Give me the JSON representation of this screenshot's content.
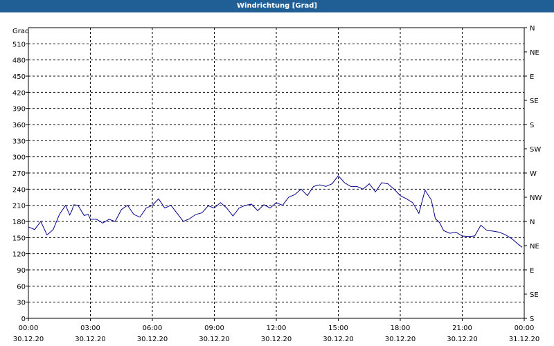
{
  "window": {
    "title": "Windrichtung [Grad]"
  },
  "chart_data": {
    "type": "line",
    "title": "Windrichtung [Grad]",
    "ylabel": "Grad",
    "xlabel": "",
    "ylim": [
      0,
      540
    ],
    "yticks": [
      0,
      30,
      60,
      90,
      120,
      150,
      180,
      210,
      240,
      270,
      300,
      330,
      360,
      390,
      420,
      450,
      480,
      510
    ],
    "right_axis_labels": [
      "S",
      "SE",
      "E",
      "NE",
      "N",
      "NW",
      "W",
      "SW",
      "S",
      "SE",
      "E",
      "NE",
      "N"
    ],
    "x_ticks": [
      {
        "time": "00:00",
        "date": "30.12.20"
      },
      {
        "time": "03:00",
        "date": "30.12.20"
      },
      {
        "time": "06:00",
        "date": "30.12.20"
      },
      {
        "time": "09:00",
        "date": "30.12.20"
      },
      {
        "time": "12:00",
        "date": "30.12.20"
      },
      {
        "time": "15:00",
        "date": "30.12.20"
      },
      {
        "time": "18:00",
        "date": "30.12.20"
      },
      {
        "time": "21:00",
        "date": "30.12.20"
      },
      {
        "time": "00:00",
        "date": "31.12.20"
      }
    ],
    "x_unit": "hours since 30.12.20 00:00",
    "grid": true,
    "line_color": "#00008b",
    "series": [
      {
        "name": "",
        "x": [
          0,
          0.3,
          0.6,
          0.9,
          1.0,
          1.2,
          1.5,
          1.8,
          2.0,
          2.1,
          2.2,
          2.4,
          2.7,
          2.9,
          3.0,
          3.3,
          3.6,
          3.9,
          4.2,
          4.5,
          4.8,
          5.1,
          5.4,
          5.7,
          6.0,
          6.3,
          6.6,
          6.9,
          7.2,
          7.5,
          7.8,
          8.1,
          8.4,
          8.7,
          9.0,
          9.3,
          9.6,
          9.9,
          10.2,
          10.5,
          10.8,
          11.1,
          11.4,
          11.7,
          12.0,
          12.3,
          12.6,
          12.9,
          13.2,
          13.5,
          13.8,
          14.1,
          14.4,
          14.7,
          15.0,
          15.3,
          15.6,
          15.9,
          16.2,
          16.5,
          16.8,
          17.1,
          17.4,
          17.7,
          18.0,
          18.3,
          18.6,
          18.9,
          19.2,
          19.5,
          19.7,
          19.9,
          20.1,
          20.4,
          20.7,
          21.0,
          21.3,
          21.6,
          21.9,
          22.2,
          22.5,
          22.8,
          23.1,
          23.4,
          23.7,
          23.9
        ],
        "y": [
          170,
          165,
          180,
          155,
          158,
          165,
          193,
          210,
          192,
          200,
          211,
          210,
          191,
          193,
          184,
          184,
          177,
          184,
          180,
          202,
          210,
          193,
          188,
          205,
          210,
          222,
          205,
          210,
          195,
          180,
          185,
          193,
          196,
          209,
          205,
          215,
          205,
          190,
          205,
          210,
          212,
          200,
          211,
          205,
          215,
          210,
          225,
          230,
          240,
          228,
          245,
          248,
          245,
          250,
          265,
          252,
          245,
          245,
          240,
          250,
          235,
          252,
          250,
          240,
          228,
          222,
          215,
          195,
          238,
          220,
          185,
          178,
          163,
          158,
          160,
          153,
          152,
          153,
          173,
          163,
          162,
          160,
          155,
          148,
          138,
          132
        ]
      }
    ]
  }
}
